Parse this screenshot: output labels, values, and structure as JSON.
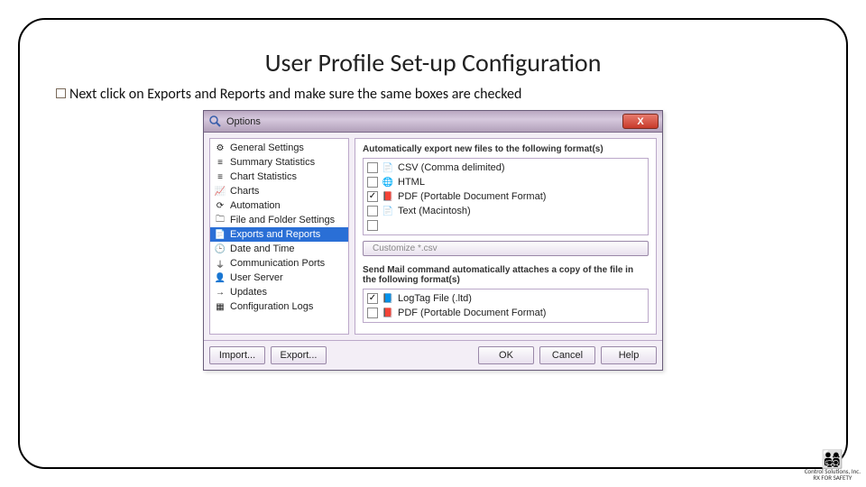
{
  "slide": {
    "title": "User Profile Set-up Configuration",
    "body": "Next click on Exports and Reports and make sure the same boxes are checked"
  },
  "window": {
    "title": "Options",
    "close_glyph": "X",
    "nav": [
      {
        "label": "General Settings",
        "icon": "⚙"
      },
      {
        "label": "Summary Statistics",
        "icon": "≡"
      },
      {
        "label": "Chart Statistics",
        "icon": "≡"
      },
      {
        "label": "Charts",
        "icon": "📈"
      },
      {
        "label": "Automation",
        "icon": "⟳"
      },
      {
        "label": "File and Folder Settings",
        "icon": "🗀"
      },
      {
        "label": "Exports and Reports",
        "icon": "📄",
        "selected": true
      },
      {
        "label": "Date and Time",
        "icon": "🕒"
      },
      {
        "label": "Communication Ports",
        "icon": "⏚"
      },
      {
        "label": "User Server",
        "icon": "👤"
      },
      {
        "label": "Updates",
        "icon": "→"
      },
      {
        "label": "Configuration Logs",
        "icon": "▦"
      }
    ],
    "section1_label": "Automatically export new files to the following format(s)",
    "export_formats": [
      {
        "checked": false,
        "icon": "📄",
        "label": "CSV (Comma delimited)"
      },
      {
        "checked": false,
        "icon": "🌐",
        "label": "HTML"
      },
      {
        "checked": true,
        "icon": "📕",
        "label": "PDF (Portable Document Format)"
      },
      {
        "checked": false,
        "icon": "📄",
        "label": "Text (Macintosh)"
      },
      {
        "checked": false,
        "icon": "",
        "label": ""
      }
    ],
    "customize_label": "Customize *.csv",
    "section2_label": "Send Mail command automatically attaches a copy of the file in the following format(s)",
    "mail_formats": [
      {
        "checked": true,
        "icon": "📘",
        "label": "LogTag File (.ltd)"
      },
      {
        "checked": false,
        "icon": "📕",
        "label": "PDF (Portable Document Format)"
      }
    ],
    "buttons": {
      "import": "Import...",
      "export": "Export...",
      "ok": "OK",
      "cancel": "Cancel",
      "help": "Help"
    }
  },
  "logo": {
    "line1": "Control Solutions, Inc.",
    "line2": "RX FOR SAFETY"
  }
}
